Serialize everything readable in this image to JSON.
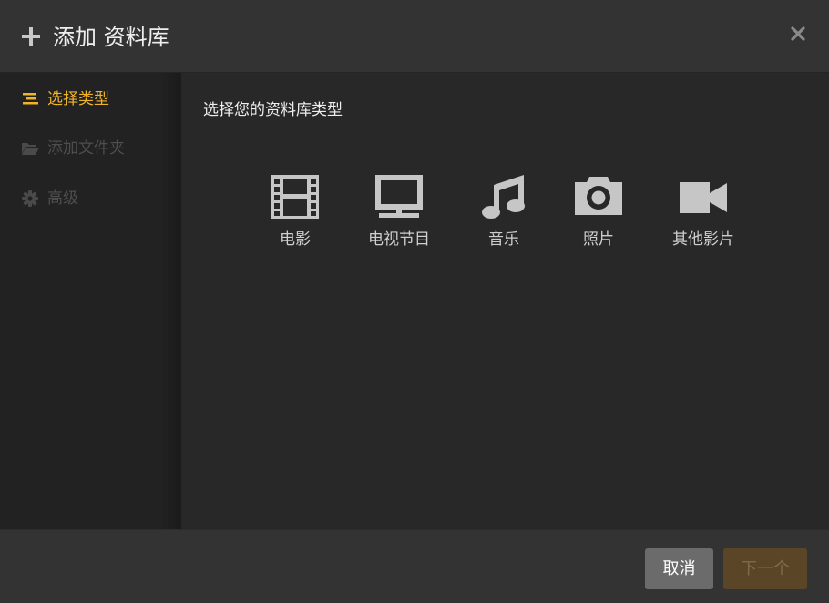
{
  "dialog": {
    "title": "添加 资料库",
    "icons": {
      "add": "plus-icon",
      "close": "close-icon"
    }
  },
  "sidebar": {
    "items": [
      {
        "label": "选择类型",
        "icon": "list-icon",
        "state": "active"
      },
      {
        "label": "添加文件夹",
        "icon": "folder-open-icon",
        "state": "disabled"
      },
      {
        "label": "高级",
        "icon": "gear-icon",
        "state": "disabled"
      }
    ]
  },
  "main": {
    "prompt": "选择您的资料库类型",
    "types": [
      {
        "label": "电影",
        "icon": "film-icon"
      },
      {
        "label": "电视节目",
        "icon": "tv-icon"
      },
      {
        "label": "音乐",
        "icon": "music-note-icon"
      },
      {
        "label": "照片",
        "icon": "camera-icon"
      },
      {
        "label": "其他影片",
        "icon": "video-camera-icon"
      }
    ]
  },
  "footer": {
    "cancel_label": "取消",
    "next_label": "下一个"
  },
  "colors": {
    "accent": "#f0b429",
    "icon_gray": "#c6c6c6",
    "next_button_bg": "#5a4527"
  }
}
